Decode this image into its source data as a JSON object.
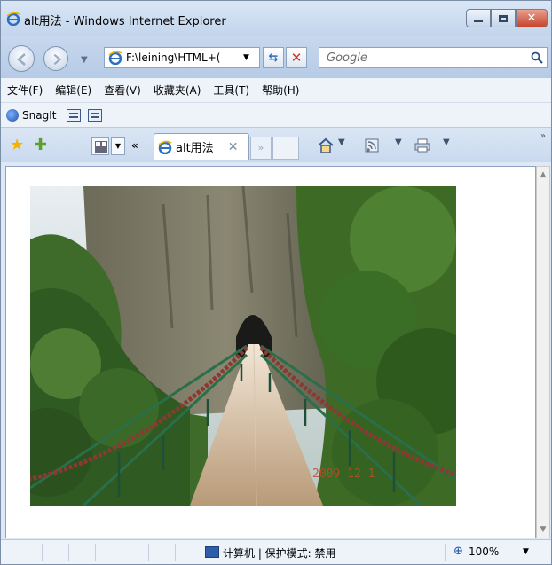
{
  "window": {
    "title": "alt用法 - Windows Internet Explorer"
  },
  "nav": {
    "address": "F:\\leining\\HTML+(",
    "search_placeholder": "Google"
  },
  "menu": {
    "items": [
      "文件(F)",
      "编辑(E)",
      "查看(V)",
      "收藏夹(A)",
      "工具(T)",
      "帮助(H)"
    ]
  },
  "links": {
    "snagit_label": "SnagIt"
  },
  "tabs": {
    "active_label": "alt用法",
    "back_label": "«",
    "more_label": "»"
  },
  "content": {
    "photo_date_stamp": "2009 12 1",
    "photo_description": "Photograph of a narrow wooden suspension bridge leading to a tunnel in a tall, forested cliff"
  },
  "status": {
    "zone": "计算机 | 保护模式: 禁用",
    "zoom": "100%"
  },
  "colors": {
    "chrome": "#dfe9f5",
    "accent": "#2b6fc5",
    "close_red": "#c6452e"
  },
  "icons": {
    "title": "ie-logo-icon",
    "back": "back-arrow-icon",
    "forward": "forward-arrow-icon",
    "refresh": "refresh-icon",
    "stop": "stop-icon",
    "search": "search-icon",
    "favorites": "favorites-star-icon",
    "add_favorites": "add-favorites-icon",
    "home": "home-icon",
    "feeds": "feeds-icon",
    "print": "print-icon",
    "zone": "computer-zone-icon",
    "zoom": "zoom-icon"
  }
}
